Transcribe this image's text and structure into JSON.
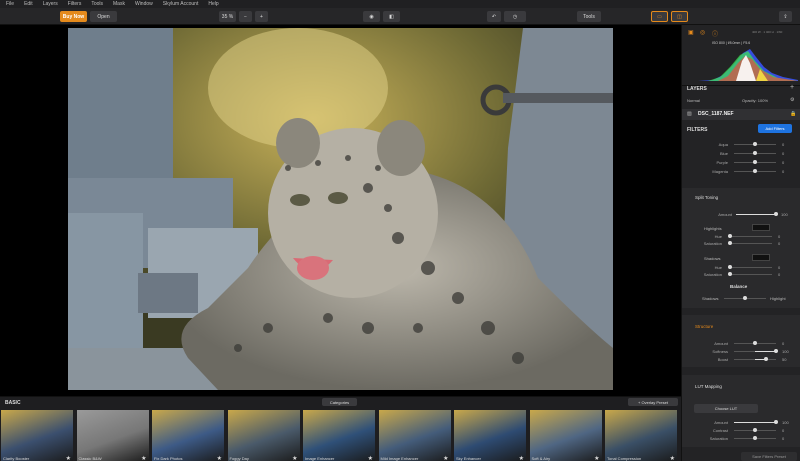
{
  "menu": [
    "File",
    "Edit",
    "Layers",
    "Filters",
    "Tools",
    "Mask",
    "Window",
    "Skylum Account",
    "Help"
  ],
  "toolbar": {
    "buy_now": "Buy Now",
    "open": "Open",
    "zoom": "35 %",
    "zoom_out": "−",
    "zoom_in": "+",
    "eye_icon": "◉",
    "compare_icon": "◧",
    "undo_icon": "↶",
    "history_icon": "◷",
    "tools": "Tools",
    "share_icon": "⇪"
  },
  "histogram": {
    "info_top": "400 W  ·  1 400 H  ·  1/60",
    "info_mid": "ISO 800  |  f/8.0mm  |  F5.6"
  },
  "layers": {
    "title": "LAYERS",
    "add": "+",
    "blend": "Normal",
    "opacity": "Opacity: 100%",
    "file": "DSC_1187.NEF"
  },
  "filters": {
    "title": "FILTERS",
    "add_button": "Add Filters",
    "hsl_rows": [
      {
        "label": "Aqua",
        "value": "0"
      },
      {
        "label": "Blue",
        "value": "0"
      },
      {
        "label": "Purple",
        "value": "0"
      },
      {
        "label": "Magenta",
        "value": "0"
      }
    ],
    "split_toning": {
      "title": "Split Toning",
      "amount_label": "Amount",
      "amount_value": "100",
      "highlights_label": "Highlights",
      "h_hue_label": "Hue",
      "h_hue_value": "0",
      "h_sat_label": "Saturation",
      "h_sat_value": "0",
      "shadows_label": "Shadows",
      "s_hue_label": "Hue",
      "s_hue_value": "0",
      "s_sat_label": "Saturation",
      "s_sat_value": "0",
      "balance_label": "Balance",
      "bal_left": "Shadows",
      "bal_right": "Highlight"
    },
    "structure": {
      "title": "Structure",
      "rows": [
        {
          "label": "Amount",
          "value": "0"
        },
        {
          "label": "Softness",
          "value": "100"
        },
        {
          "label": "Boost",
          "value": "50"
        }
      ]
    },
    "lut": {
      "title": "LUT Mapping",
      "choose": "Choose LUT",
      "rows": [
        {
          "label": "Amount",
          "value": "100"
        },
        {
          "label": "Contrast",
          "value": "0"
        },
        {
          "label": "Saturation",
          "value": "0"
        }
      ]
    },
    "save_preset": "Save Filters Preset"
  },
  "presets": {
    "category": "BASIC",
    "categories_button": "Categories",
    "overlay_button": "+ Overlay Preset",
    "items": [
      {
        "name": "Clarity Booster"
      },
      {
        "name": "Classic B&W"
      },
      {
        "name": "Fix Dark Photos"
      },
      {
        "name": "Foggy Day"
      },
      {
        "name": "Image Enhancer"
      },
      {
        "name": "Mild Image Enhancer"
      },
      {
        "name": "Sky Enhancer"
      },
      {
        "name": "Soft & Airy"
      },
      {
        "name": "Tonal Compression"
      }
    ]
  },
  "colors": {
    "accent": "#e48a1c",
    "add_filters": "#1e73e0"
  }
}
